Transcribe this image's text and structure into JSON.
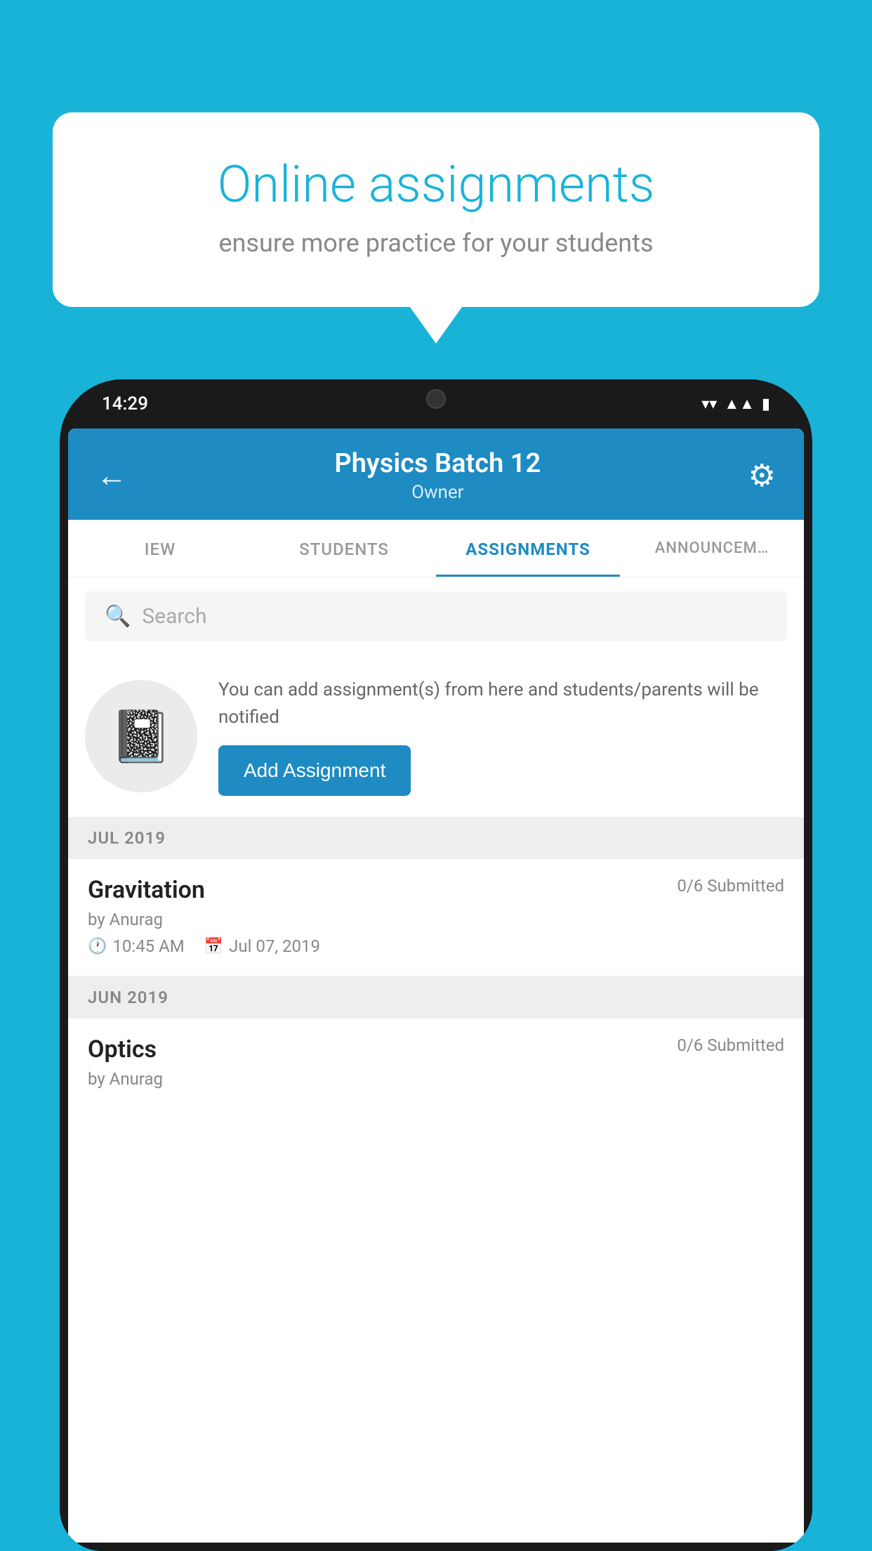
{
  "background_color": "#1ab3d8",
  "speech_bubble": {
    "title": "Online assignments",
    "subtitle": "ensure more practice for your students"
  },
  "phone": {
    "status_bar": {
      "time": "14:29",
      "icons": [
        "wifi",
        "signal",
        "battery"
      ]
    },
    "header": {
      "title": "Physics Batch 12",
      "subtitle": "Owner",
      "back_label": "←",
      "gear_label": "⚙"
    },
    "tabs": [
      {
        "label": "IEW",
        "active": false
      },
      {
        "label": "STUDENTS",
        "active": false
      },
      {
        "label": "ASSIGNMENTS",
        "active": true
      },
      {
        "label": "ANNOUNCEM…",
        "active": false
      }
    ],
    "search": {
      "placeholder": "Search"
    },
    "promo": {
      "text": "You can add assignment(s) from here and students/parents will be notified",
      "button_label": "Add Assignment"
    },
    "sections": [
      {
        "header": "JUL 2019",
        "assignments": [
          {
            "title": "Gravitation",
            "submitted": "0/6 Submitted",
            "by": "by Anurag",
            "time": "10:45 AM",
            "date": "Jul 07, 2019"
          }
        ]
      },
      {
        "header": "JUN 2019",
        "assignments": [
          {
            "title": "Optics",
            "submitted": "0/6 Submitted",
            "by": "by Anurag"
          }
        ]
      }
    ]
  }
}
